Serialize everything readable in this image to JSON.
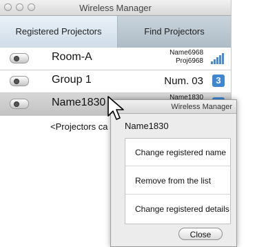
{
  "window": {
    "title": "Wireless Manager"
  },
  "tabs": [
    {
      "label": "Registered Projectors",
      "active": true
    },
    {
      "label": "Find Projectors",
      "active": false
    }
  ],
  "rows": [
    {
      "name": "Room-A",
      "line1": "Name6968",
      "line2": "Proj6968",
      "indicator": "signal-strength-icon"
    },
    {
      "name": "Group 1",
      "num": "Num. 03",
      "badge": "3"
    },
    {
      "name": "Name1830",
      "line1": "Name1830",
      "badge": "3",
      "selected": true
    },
    {
      "message": "<Projectors ca"
    }
  ],
  "popup": {
    "title": "Wireless Manager",
    "selected_name": "Name1830",
    "menu": [
      "Change registered name",
      "Remove from the list",
      "Change registered details"
    ],
    "close_label": "Close"
  },
  "colors": {
    "accent": "#3d86d0",
    "selected_row": "#c8c8c8",
    "tab_active": "#dbe6f0"
  }
}
